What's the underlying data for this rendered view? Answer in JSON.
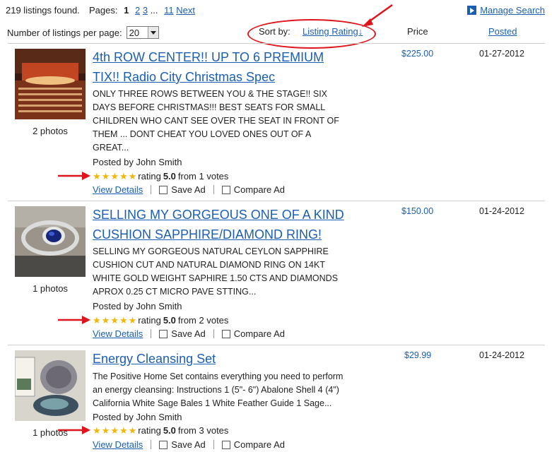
{
  "top": {
    "found": "219 listings found.",
    "pages_label": "Pages:",
    "pages": [
      "1",
      "2",
      "3",
      "...",
      "11",
      "Next"
    ],
    "manage_search": "Manage Search",
    "per_page_label": "Number of listings per page:",
    "per_page_value": "20",
    "sort_by_label": "Sort by:",
    "sort_link": "Listing Rating↓",
    "price_header": "Price",
    "posted_header": "Posted"
  },
  "listings": [
    {
      "title_line1": "4th ROW CENTER!! UP TO 6 PREMIUM",
      "title_line2": "TIX!! Radio City Christmas Spec",
      "desc": [
        "ONLY THREE ROWS BETWEEN YOU & THE STAGE!! SIX",
        "DAYS BEFORE CHRISTMAS!!! BEST SEATS FOR SMALL",
        "CHILDREN WHO CANT SEE OVER THE SEAT IN FRONT OF",
        "THEM ... DONT CHEAT YOU LOVED ONES OUT OF A",
        "GREAT..."
      ],
      "photos": "2 photos",
      "posted_by": "Posted by John Smith",
      "rating_word": "rating",
      "rating_value": "5.0",
      "votes": "from 1 votes",
      "view_details": "View Details",
      "save_ad": "Save Ad",
      "compare_ad": "Compare Ad",
      "price": "$225.00",
      "date": "01-27-2012"
    },
    {
      "title_line1": "SELLING MY GORGEOUS ONE OF A KIND",
      "title_line2": "CUSHION SAPPHIRE/DIAMOND RING!",
      "desc": [
        "SELLING MY GORGEOUS NATURAL CEYLON SAPPHIRE",
        "CUSHION CUT AND NATURAL DIAMOND RING ON 14KT",
        "WHITE GOLD WEIGHT SAPHIRE 1.50 CTS AND DIAMONDS",
        "APROX 0.25 CT MICRO PAVE STTING..."
      ],
      "photos": "1 photos",
      "posted_by": "Posted by John Smith",
      "rating_word": "rating",
      "rating_value": "5.0",
      "votes": "from 2 votes",
      "view_details": "View Details",
      "save_ad": "Save Ad",
      "compare_ad": "Compare Ad",
      "price": "$150.00",
      "date": "01-24-2012"
    },
    {
      "title_line1": "Energy Cleansing Set",
      "title_line2": "",
      "desc": [
        "The Positive Home Set contains everything you need to perform",
        "an energy cleansing: Instructions 1 (5\"- 6\") Abalone Shell 4 (4\")",
        "California White Sage Bales 1 White Feather Guide 1 Sage..."
      ],
      "photos": "1 photos",
      "posted_by": "Posted by John Smith",
      "rating_word": "rating",
      "rating_value": "5.0",
      "votes": "from 3 votes",
      "view_details": "View Details",
      "save_ad": "Save Ad",
      "compare_ad": "Compare Ad",
      "price": "$29.99",
      "date": "01-24-2012"
    }
  ],
  "colors": {
    "link": "#1a5fb4",
    "annotation": "#e0141c",
    "star": "#f2b705"
  },
  "icons": [
    "play-icon",
    "dropdown-arrow-icon",
    "star-icon",
    "checkbox-icon",
    "red-arrow-annotation"
  ]
}
